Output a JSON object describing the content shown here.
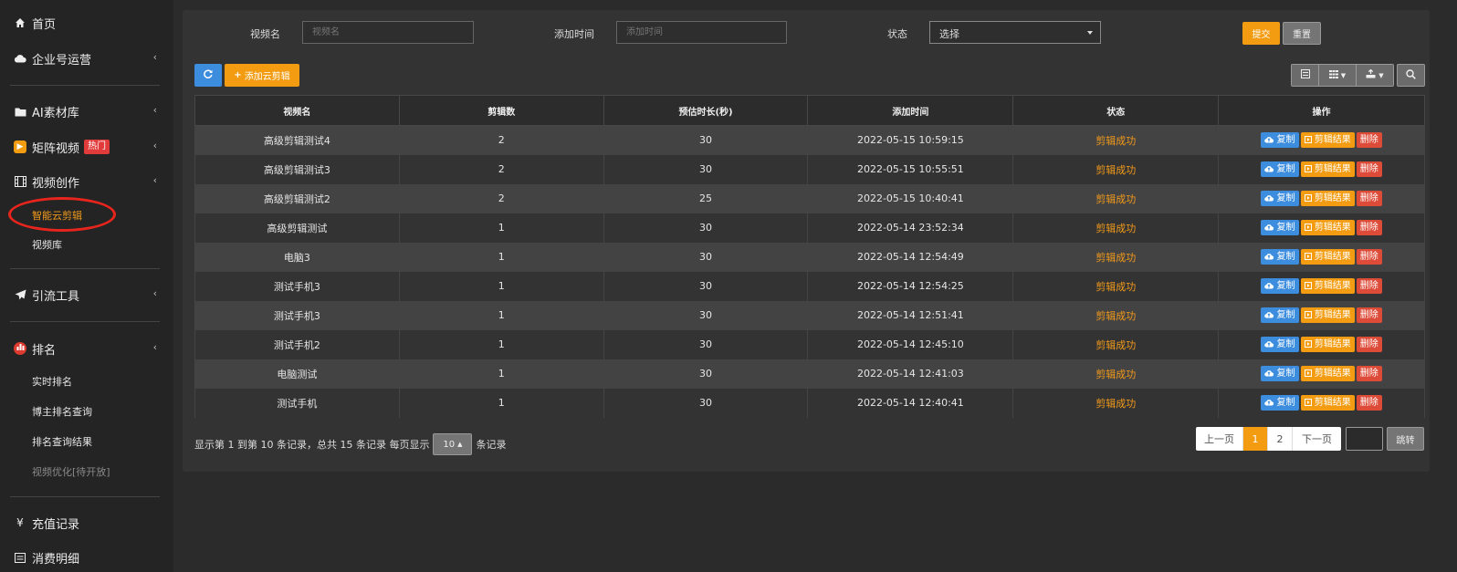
{
  "sidebar": {
    "home": "首页",
    "enterprise": "企业号运营",
    "ai_library": "AI素材库",
    "matrix_video": "矩阵视频",
    "hot_badge": "热门",
    "video_creation": "视频创作",
    "smart_cloud_edit": "智能云剪辑",
    "video_library": "视频库",
    "traffic_tools": "引流工具",
    "ranking": "排名",
    "realtime_rank": "实时排名",
    "blogger_rank_query": "博主排名查询",
    "rank_query_result": "排名查询结果",
    "video_optimize": "视频优化[待开放]",
    "recharge": "充值记录",
    "consume_detail": "消费明细",
    "yen_symbol": "¥",
    "accent_color": "#f29a1a"
  },
  "filters": {
    "video_name_label": "视频名",
    "video_name_placeholder": "视频名",
    "add_time_label": "添加时间",
    "add_time_placeholder": "添加时间",
    "status_label": "状态",
    "status_value": "选择",
    "submit_label": "提交",
    "reset_label": "重置"
  },
  "toolbar": {
    "refresh_icon": "refresh-icon",
    "add_label": "添加云剪辑"
  },
  "table": {
    "columns": [
      "视频名",
      "剪辑数",
      "预估时长(秒)",
      "添加时间",
      "状态",
      "操作"
    ],
    "actions": {
      "copy": "复制",
      "result": "剪辑结果",
      "delete": "删除"
    },
    "rows": [
      {
        "name": "高级剪辑测试4",
        "clips": "2",
        "duration": "30",
        "time": "2022-05-15 10:59:15",
        "status": "剪辑成功"
      },
      {
        "name": "高级剪辑测试3",
        "clips": "2",
        "duration": "30",
        "time": "2022-05-15 10:55:51",
        "status": "剪辑成功"
      },
      {
        "name": "高级剪辑测试2",
        "clips": "2",
        "duration": "25",
        "time": "2022-05-15 10:40:41",
        "status": "剪辑成功"
      },
      {
        "name": "高级剪辑测试",
        "clips": "1",
        "duration": "30",
        "time": "2022-05-14 23:52:34",
        "status": "剪辑成功"
      },
      {
        "name": "电脑3",
        "clips": "1",
        "duration": "30",
        "time": "2022-05-14 12:54:49",
        "status": "剪辑成功"
      },
      {
        "name": "测试手机3",
        "clips": "1",
        "duration": "30",
        "time": "2022-05-14 12:54:25",
        "status": "剪辑成功"
      },
      {
        "name": "测试手机3",
        "clips": "1",
        "duration": "30",
        "time": "2022-05-14 12:51:41",
        "status": "剪辑成功"
      },
      {
        "name": "测试手机2",
        "clips": "1",
        "duration": "30",
        "time": "2022-05-14 12:45:10",
        "status": "剪辑成功"
      },
      {
        "name": "电脑测试",
        "clips": "1",
        "duration": "30",
        "time": "2022-05-14 12:41:03",
        "status": "剪辑成功"
      },
      {
        "name": "测试手机",
        "clips": "1",
        "duration": "30",
        "time": "2022-05-14 12:40:41",
        "status": "剪辑成功"
      }
    ]
  },
  "footer": {
    "info_text": "显示第 1 到第 10 条记录，总共 15 条记录 每页显示",
    "page_size": "10",
    "records_suffix": "条记录",
    "prev": "上一页",
    "page1": "1",
    "page2": "2",
    "next": "下一页",
    "jump": "跳转"
  }
}
